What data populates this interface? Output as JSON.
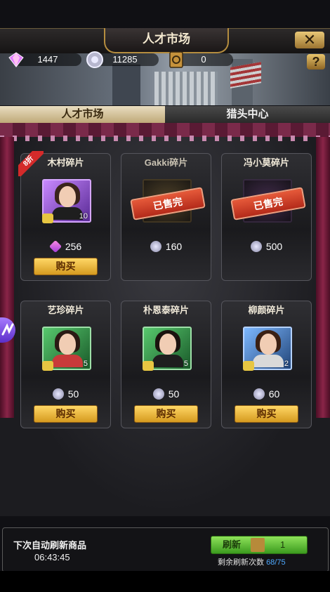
{
  "title": "人才市场",
  "resources": {
    "gems": "1447",
    "coins": "11285",
    "cards": "0"
  },
  "icons": {
    "close": "close-icon",
    "help": "help-icon",
    "gem": "gem-icon",
    "coin": "coin-icon",
    "card": "card-icon"
  },
  "tabs": [
    {
      "label": "人才市场",
      "active": true
    },
    {
      "label": "猎头中心",
      "active": false
    }
  ],
  "items": [
    {
      "name": "木村碎片",
      "discount": "8折",
      "count": "10",
      "currency": "gem",
      "price": "256",
      "buy_label": "购买",
      "sold_out": false
    },
    {
      "name": "Gakki碎片",
      "count": "",
      "currency": "coin",
      "price": "160",
      "sold_out": true,
      "sold_out_label": "已售完"
    },
    {
      "name": "冯小莫碎片",
      "count": "",
      "currency": "coin",
      "price": "500",
      "sold_out": true,
      "sold_out_label": "已售完"
    },
    {
      "name": "艺珍碎片",
      "count": "5",
      "currency": "coin",
      "price": "50",
      "buy_label": "购买",
      "sold_out": false
    },
    {
      "name": "朴恩泰碎片",
      "count": "5",
      "currency": "coin",
      "price": "50",
      "buy_label": "购买",
      "sold_out": false
    },
    {
      "name": "柳颜碎片",
      "count": "2",
      "currency": "coin",
      "price": "60",
      "buy_label": "购买",
      "sold_out": false
    }
  ],
  "refresh": {
    "next_label": "下次自动刷新商品",
    "timer": "06:43:45",
    "button_label": "刷新",
    "cost": "1",
    "remaining_label": "剩余刷新次数",
    "remaining_value": "68/75"
  }
}
